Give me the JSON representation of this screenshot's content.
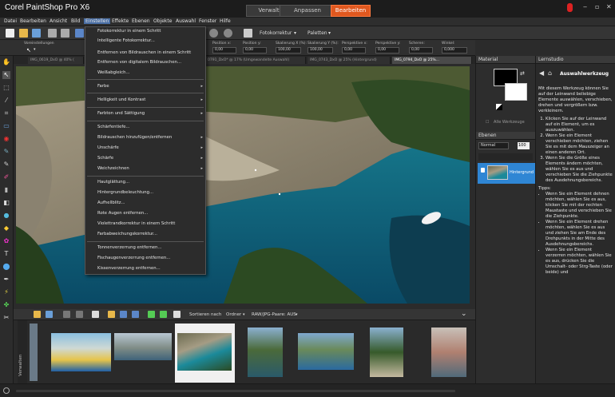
{
  "app": {
    "title": "Corel PaintShop Pro X6",
    "mode_tabs": [
      "Verwalten",
      "Anpassen",
      "Bearbeiten"
    ],
    "active_mode": "Bearbeiten",
    "accent_color": "#e0581f"
  },
  "menu": {
    "items": [
      "Datei",
      "Bearbeiten",
      "Ansicht",
      "Bild",
      "Einstellen",
      "Effekte",
      "Ebenen",
      "Objekte",
      "Auswahl",
      "Fenster",
      "Hilfe"
    ],
    "active": "Einstellen"
  },
  "toolbar": {
    "fotokorrektur": "Fotokorrektur",
    "paletten": "Paletten"
  },
  "options": {
    "voreinstellungen": "Voreinstellungen",
    "fields": [
      {
        "label": "Position x:",
        "value": "0,00"
      },
      {
        "label": "Position y:",
        "value": "0,00"
      },
      {
        "label": "Skalierung X (%):",
        "value": "100,00"
      },
      {
        "label": "Skalierung Y (%):",
        "value": "100,00"
      },
      {
        "label": "Perspektive x:",
        "value": "0,00"
      },
      {
        "label": "Perspektive y:",
        "value": "0,00"
      },
      {
        "label": "Scheren:",
        "value": "0,00"
      },
      {
        "label": "Winkel:",
        "value": "0,000"
      }
    ]
  },
  "doc_tabs": [
    "IMG_0619_DxO @ 40% (",
    "0791_DxO* @ 17% (Umgewandelte Auswahl)",
    "IMG_0743_DxO @ 25% (Hintergrund)",
    "IMG_0794_DxO @ 25%..."
  ],
  "dropdown": {
    "items": [
      {
        "label": "Fotokorrektur in einem Schritt",
        "arrow": false
      },
      {
        "label": "Intelligente Fotokorrektur...",
        "arrow": false
      },
      {
        "label": "Entfernen von Bildrauschen in einem Schritt",
        "arrow": false
      },
      {
        "label": "Entfernen von digitalem Bildrauschen...",
        "arrow": false
      },
      {
        "label": "Weißabgleich...",
        "arrow": false
      },
      {
        "label": "Farbe",
        "arrow": true
      },
      {
        "label": "Helligkeit und Kontrast",
        "arrow": true
      },
      {
        "label": "Farbton und Sättigung",
        "arrow": true
      },
      {
        "label": "Schärfentiefe...",
        "arrow": false
      },
      {
        "label": "Bildrauschen hinzufügen/entfernen",
        "arrow": true
      },
      {
        "label": "Unschärfe",
        "arrow": true
      },
      {
        "label": "Schärfe",
        "arrow": true
      },
      {
        "label": "Weichzeichnen",
        "arrow": true
      },
      {
        "label": "Hautglättung...",
        "arrow": false
      },
      {
        "label": "Hintergrundbeleuchtung...",
        "arrow": false
      },
      {
        "label": "Aufhellblitz...",
        "arrow": false
      },
      {
        "label": "Rote Augen entfernen...",
        "arrow": false
      },
      {
        "label": "Violettrandkorrektur in einem Schritt",
        "arrow": false
      },
      {
        "label": "Farbabweichungskorrektur...",
        "arrow": false
      },
      {
        "label": "Tonnenverzerrung entfernen...",
        "arrow": false
      },
      {
        "label": "Fischaugenverzerrung entfernen...",
        "arrow": false
      },
      {
        "label": "Kissenverzerrung entfernen...",
        "arrow": false
      }
    ]
  },
  "organizer": {
    "sortieren": "Sortieren nach",
    "ordner": "Ordner",
    "raw_jpg": "RAW/JPG-Paare: AUS",
    "side_label": "Verwalten"
  },
  "material": {
    "title": "Material",
    "alle_werkzeuge": "Alle Werkzeuge"
  },
  "layers": {
    "title": "Ebenen",
    "blend_mode": "Normal",
    "opacity": "100",
    "layer_name": "Hintergrund"
  },
  "learn": {
    "title": "Lernstudio",
    "heading": "Auswahlwerkzeug",
    "intro": "Mit diesem Werkzeug können Sie auf der Leinwand beliebige Elemente auswählen, verschieben, drehen und vergrößern bzw. verkleinern.",
    "steps": [
      "Klicken Sie auf der Leinwand auf ein Element, um es auszuwählen.",
      "Wenn Sie ein Element verschieben möchten, ziehen Sie es mit dem Mauszeiger an einen anderen Ort.",
      "Wenn Sie die Größe eines Elements ändern möchten, wählen Sie es aus und verschieben Sie die Ziehpunkte des Ausdehnungsbereichs."
    ],
    "tips_label": "Tipps:",
    "tips": [
      "Wenn Sie ein Element dehnen möchten, wählen Sie es aus, klicken Sie mit der rechten Maustaste und verschieben Sie die Ziehpunkte.",
      "Wenn Sie ein Element drehen möchten, wählen Sie es aus und ziehen Sie am Ende des Drehpunkts in der Mitte des Ausdehnungsbereichs.",
      "Wenn Sie ein Element verzerren möchten, wählen Sie es aus, drücken Sie die Umschalt- oder Strg-Taste (oder beide) und"
    ]
  }
}
